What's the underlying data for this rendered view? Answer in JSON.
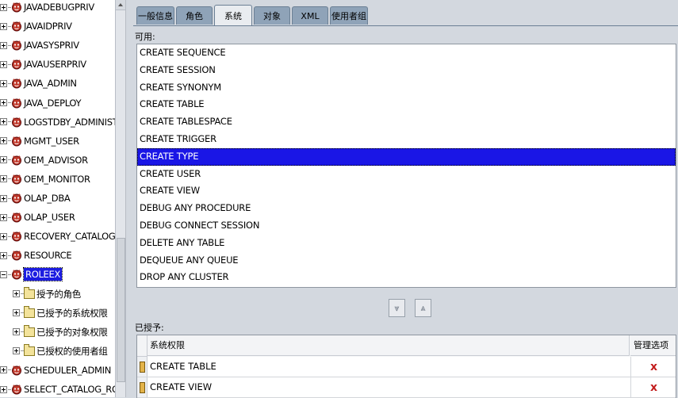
{
  "tree": {
    "items": [
      {
        "label": "JAVADEBUGPRIV",
        "type": "role"
      },
      {
        "label": "JAVAIDPRIV",
        "type": "role"
      },
      {
        "label": "JAVASYSPRIV",
        "type": "role"
      },
      {
        "label": "JAVAUSERPRIV",
        "type": "role"
      },
      {
        "label": "JAVA_ADMIN",
        "type": "role"
      },
      {
        "label": "JAVA_DEPLOY",
        "type": "role"
      },
      {
        "label": "LOGSTDBY_ADMINISTRATO",
        "type": "role"
      },
      {
        "label": "MGMT_USER",
        "type": "role"
      },
      {
        "label": "OEM_ADVISOR",
        "type": "role"
      },
      {
        "label": "OEM_MONITOR",
        "type": "role"
      },
      {
        "label": "OLAP_DBA",
        "type": "role"
      },
      {
        "label": "OLAP_USER",
        "type": "role"
      },
      {
        "label": "RECOVERY_CATALOG_OW",
        "type": "role"
      },
      {
        "label": "RESOURCE",
        "type": "role"
      },
      {
        "label": "ROLEEX",
        "type": "role",
        "selected": true,
        "expanded": true
      },
      {
        "label": "授予的角色",
        "type": "folder"
      },
      {
        "label": "已授予的系统权限",
        "type": "folder"
      },
      {
        "label": "已授予的对象权限",
        "type": "folder"
      },
      {
        "label": "已授权的使用者组",
        "type": "folder"
      },
      {
        "label": "SCHEDULER_ADMIN",
        "type": "role"
      },
      {
        "label": "SELECT_CATALOG_ROLE",
        "type": "role"
      }
    ]
  },
  "tabs": [
    {
      "label": "一般信息",
      "active": false
    },
    {
      "label": "角色",
      "active": false
    },
    {
      "label": "系统",
      "active": true
    },
    {
      "label": "对象",
      "active": false
    },
    {
      "label": "XML",
      "active": false
    },
    {
      "label": "使用者组",
      "active": false
    }
  ],
  "available": {
    "label": "可用:",
    "items": [
      {
        "label": "CREATE SEQUENCE"
      },
      {
        "label": "CREATE SESSION"
      },
      {
        "label": "CREATE SYNONYM"
      },
      {
        "label": "CREATE TABLE"
      },
      {
        "label": "CREATE TABLESPACE"
      },
      {
        "label": "CREATE TRIGGER"
      },
      {
        "label": "CREATE TYPE",
        "selected": true
      },
      {
        "label": "CREATE USER"
      },
      {
        "label": "CREATE VIEW"
      },
      {
        "label": "DEBUG ANY PROCEDURE"
      },
      {
        "label": "DEBUG CONNECT SESSION"
      },
      {
        "label": "DELETE ANY TABLE"
      },
      {
        "label": "DEQUEUE ANY QUEUE"
      },
      {
        "label": "DROP ANY CLUSTER"
      }
    ]
  },
  "buttons": {
    "move_down_symbol": "⩔",
    "move_up_symbol": "⩓"
  },
  "granted": {
    "label": "已授予:",
    "columns": [
      "系统权限",
      "管理选项"
    ],
    "rows": [
      {
        "privilege": "CREATE TABLE",
        "admin_mark": "x"
      },
      {
        "privilege": "CREATE VIEW",
        "admin_mark": "x"
      }
    ]
  },
  "colors": {
    "selection": "#1a16e6",
    "tab_inactive": "#8fa3b8",
    "admin_mark": "#c31e1e"
  }
}
